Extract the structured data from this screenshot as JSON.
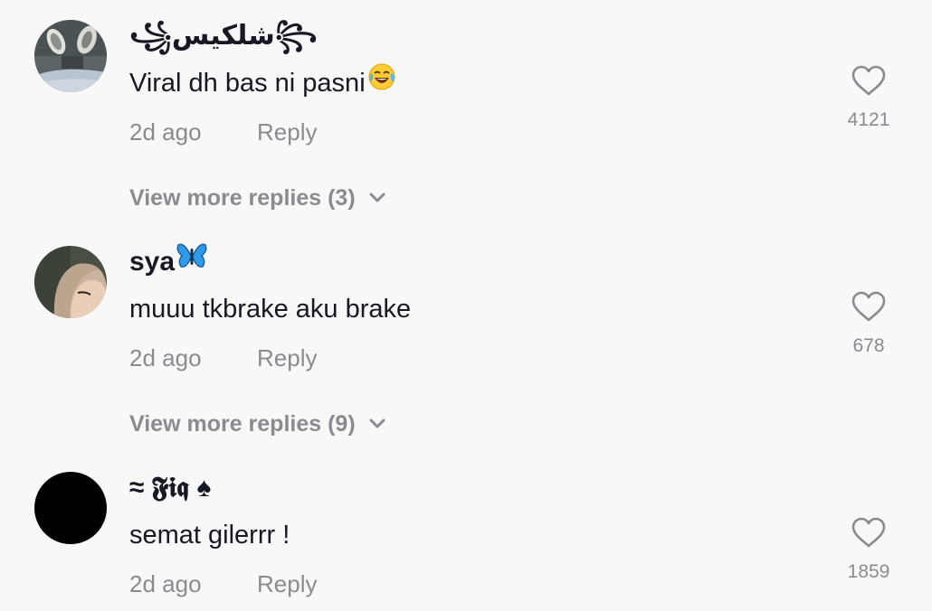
{
  "comments": [
    {
      "username": "꧁شلكيس꧂",
      "text": "Viral dh bas ni pasni",
      "time": "2d ago",
      "reply_label": "Reply",
      "like_count": "4121",
      "more_replies": "View more replies (3)",
      "avatar_icon": "shoes-photo-avatar",
      "emoji_icon": "tears-of-joy-emoji"
    },
    {
      "username": "sya",
      "text": "muuu tkbrake aku brake",
      "time": "2d ago",
      "reply_label": "Reply",
      "like_count": "678",
      "more_replies": "View more replies (9)",
      "avatar_icon": "hijab-photo-avatar",
      "emoji_icon": "blue-butterfly-emoji"
    },
    {
      "username": "≈ 𝕱𝖎𝖖 ♠",
      "text": "semat gilerrr !",
      "time": "2d ago",
      "reply_label": "Reply",
      "like_count": "1859",
      "avatar_icon": "black-circle-avatar"
    }
  ],
  "colors": {
    "background": "#f8f8f8",
    "primary_text": "#161823",
    "secondary_text": "#8a8b91"
  }
}
